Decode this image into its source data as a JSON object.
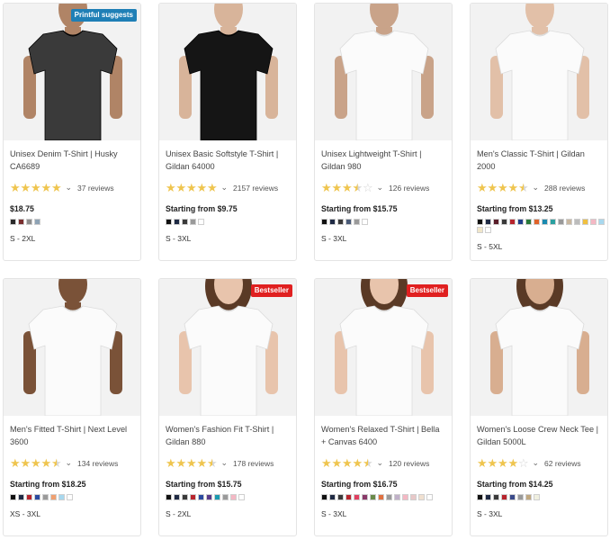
{
  "products": [
    {
      "title": "Unisex Denim T-Shirt | Husky CA6689",
      "badge": "Printful suggests",
      "badge_color": "#1f7fb6",
      "stars": [
        "full",
        "full",
        "full",
        "full",
        "full"
      ],
      "reviews": "37 reviews",
      "price": "$18.75",
      "swatches": [
        "#2b2b2b",
        "#7a2e2e",
        "#8e8e8e",
        "#8ea3b5"
      ],
      "sizes": "S - 2XL",
      "shirt_color": "#3a3a3a",
      "skin": "#b08466",
      "model": "man"
    },
    {
      "title": "Unisex Basic Softstyle T-Shirt | Gildan 64000",
      "badge": "",
      "badge_color": "",
      "stars": [
        "full",
        "full",
        "full",
        "full",
        "full"
      ],
      "reviews": "2157 reviews",
      "price": "Starting from $9.75",
      "swatches": [
        "#111111",
        "#1f2a44",
        "#3a3a3a",
        "#9a9a9a",
        "#ffffff"
      ],
      "sizes": "S - 3XL",
      "shirt_color": "#151515",
      "skin": "#d8b49a",
      "model": "man"
    },
    {
      "title": "Unisex Lightweight T-Shirt | Gildan 980",
      "badge": "",
      "badge_color": "",
      "stars": [
        "full",
        "full",
        "full",
        "half",
        "empty"
      ],
      "reviews": "126 reviews",
      "price": "Starting from $15.75",
      "swatches": [
        "#111111",
        "#1f2a44",
        "#3a3a3a",
        "#4a5b78",
        "#9a9a9a",
        "#ffffff"
      ],
      "sizes": "S - 3XL",
      "shirt_color": "#fbfbfb",
      "skin": "#c9a389",
      "model": "man"
    },
    {
      "title": "Men's Classic T-Shirt | Gildan 2000",
      "badge": "",
      "badge_color": "",
      "stars": [
        "full",
        "full",
        "full",
        "full",
        "half"
      ],
      "reviews": "288 reviews",
      "price": "Starting from $13.25",
      "swatches": [
        "#111111",
        "#1f2a44",
        "#5a1e2a",
        "#3a3a3a",
        "#b8242d",
        "#1f3f8a",
        "#2a7a3a",
        "#e0632a",
        "#1a8ab0",
        "#2aa0a0",
        "#9a9a9a",
        "#c9b8a0",
        "#bcbcbc",
        "#f0c040",
        "#f4b8c4",
        "#a8d8ee",
        "#f0e6c8",
        "#ffffff"
      ],
      "sizes": "S - 5XL",
      "shirt_color": "#fbfbfb",
      "skin": "#e2c0a8",
      "model": "man"
    },
    {
      "title": "Men's Fitted T-Shirt | Next Level 3600",
      "badge": "",
      "badge_color": "",
      "stars": [
        "full",
        "full",
        "full",
        "full",
        "half"
      ],
      "reviews": "134 reviews",
      "price": "Starting from $18.25",
      "swatches": [
        "#111111",
        "#1f2a44",
        "#b8242d",
        "#2a4aa0",
        "#9a9a9a",
        "#f0a070",
        "#a8d8ee",
        "#ffffff"
      ],
      "sizes": "XS - 3XL",
      "shirt_color": "#fbfbfb",
      "skin": "#7a5238",
      "model": "man"
    },
    {
      "title": "Women's Fashion Fit T-Shirt | Gildan 880",
      "badge": "Bestseller",
      "badge_color": "#e02020",
      "stars": [
        "full",
        "full",
        "full",
        "full",
        "half"
      ],
      "reviews": "178 reviews",
      "price": "Starting from $15.75",
      "swatches": [
        "#111111",
        "#1f2a44",
        "#3a3a3a",
        "#b8242d",
        "#2a4aa0",
        "#5a3a8a",
        "#1a9ab0",
        "#9a9a9a",
        "#f4b8c4",
        "#ffffff"
      ],
      "sizes": "S - 2XL",
      "shirt_color": "#fbfbfb",
      "skin": "#e8c4ac",
      "model": "woman"
    },
    {
      "title": "Women's Relaxed T-Shirt | Bella + Canvas 6400",
      "badge": "Bestseller",
      "badge_color": "#e02020",
      "stars": [
        "full",
        "full",
        "full",
        "full",
        "half"
      ],
      "reviews": "120 reviews",
      "price": "Starting from $16.75",
      "swatches": [
        "#111111",
        "#1f2a44",
        "#3a3a3a",
        "#b8242d",
        "#e04060",
        "#8a3a6a",
        "#6a8a4a",
        "#e07040",
        "#9a9a9a",
        "#c0b0c8",
        "#f4b8c4",
        "#e8c8c8",
        "#f0e0d0",
        "#ffffff"
      ],
      "sizes": "S - 3XL",
      "shirt_color": "#fbfbfb",
      "skin": "#e8c4ac",
      "model": "woman"
    },
    {
      "title": "Women's Loose Crew Neck Tee | Gildan 5000L",
      "badge": "",
      "badge_color": "",
      "stars": [
        "full",
        "full",
        "full",
        "full",
        "empty"
      ],
      "reviews": "62 reviews",
      "price": "Starting from $14.25",
      "swatches": [
        "#111111",
        "#1f2a44",
        "#3a3a3a",
        "#b8242d",
        "#3a4a8a",
        "#9a9a9a",
        "#c0a880",
        "#f0f0e0"
      ],
      "sizes": "S - 3XL",
      "shirt_color": "#fbfbfb",
      "skin": "#d8ae90",
      "model": "woman"
    }
  ]
}
